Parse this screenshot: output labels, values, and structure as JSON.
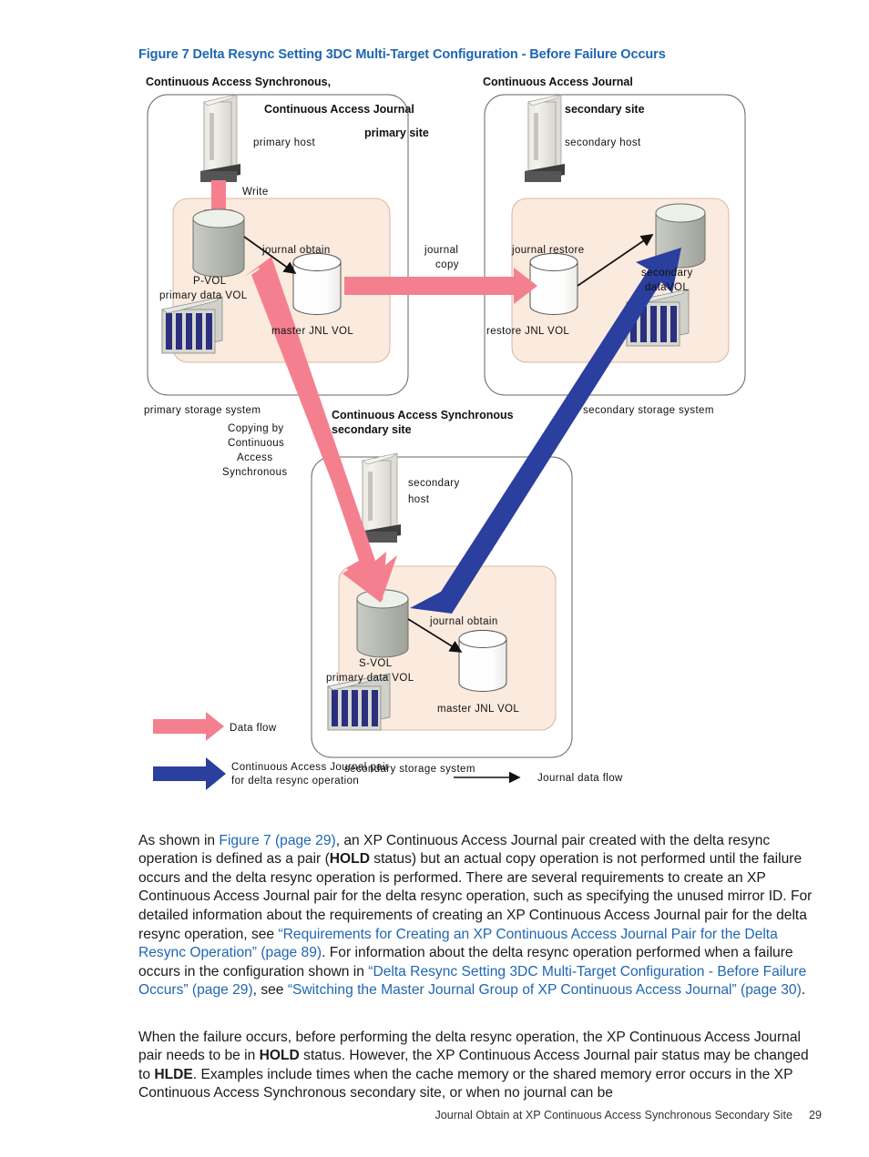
{
  "figure": {
    "caption": "Figure 7 Delta Resync Setting 3DC Multi-Target Configuration - Before Failure Occurs",
    "caption_color": "#1f66b0",
    "top_left_site": {
      "title_line1": "Continuous Access Synchronous,",
      "title_line2": "Continuous Access Journal",
      "title_line3": "primary site",
      "host_label": "primary host",
      "write_label": "Write",
      "data_vol_line1": "P-VOL",
      "data_vol_line2": "primary data VOL",
      "journal_obtain_label": "journal obtain",
      "jnl_vol_label": "master JNL VOL",
      "storage_system_label": "primary storage system"
    },
    "top_right_site": {
      "title_line1": "Continuous Access Journal",
      "title_line2": "secondary site",
      "host_label": "secondary host",
      "journal_restore_label": "journal restore",
      "data_vol_line1": "secondary",
      "data_vol_line2": "dataVOL",
      "jnl_vol_label": "restore JNL VOL",
      "storage_system_label": "secondary storage system"
    },
    "bottom_site": {
      "title_line1": "Continuous Access Synchronous",
      "title_line2": "secondary site",
      "host_line1": "secondary",
      "host_line2": "host",
      "data_vol_line1": "S-VOL",
      "data_vol_line2": "primary data VOL",
      "journal_obtain_label": "journal obtain",
      "jnl_vol_label": "master JNL VOL",
      "storage_system_label": "secondary storage system"
    },
    "journal_copy_label_line1": "journal",
    "journal_copy_label_line2": "copy",
    "copying_label_line1": "Copying by",
    "copying_label_line2": "Continuous",
    "copying_label_line3": "Access",
    "copying_label_line4": "Synchronous",
    "legend": {
      "data_flow": "Data flow",
      "ca_journal_pair_line1": "Continuous Access Journal pair",
      "ca_journal_pair_line2": "for delta resync operation",
      "journal_data_flow": "Journal data flow"
    },
    "colors": {
      "pink_arrow": "#f4808f",
      "blue_arrow": "#2a3f9e",
      "site_fill": "#fbeade",
      "gray_cylinder": "#b9bcb4",
      "white_cylinder": "#ffffff",
      "array_blue": "#2b2f7e",
      "outline": "#555555"
    }
  },
  "paragraph1": {
    "s1": "As shown in ",
    "link1": "Figure 7 (page 29)",
    "s2": ", an XP Continuous Access Journal pair created with the delta resync operation is defined as a pair (",
    "b1": "HOLD",
    "s3": " status) but an actual copy operation is not performed until the failure occurs and the delta resync operation is performed. There are several requirements to create an XP Continuous Access Journal pair for the delta resync operation, such as specifying the unused mirror ID. For detailed information about the requirements of creating an XP Continuous Access Journal pair for the delta resync operation, see ",
    "link2": "“Requirements for Creating an XP Continuous Access Journal Pair for the Delta Resync Operation” (page 89)",
    "s4": ". For information about the delta resync operation performed when a failure occurs in the configuration shown in ",
    "link3": "“Delta Resync Setting 3DC Multi-Target Configuration - Before Failure Occurs” (page 29)",
    "s5": ", see ",
    "link4": "“Switching the Master Journal Group of XP Continuous Access Journal” (page 30)",
    "s6": "."
  },
  "paragraph2": {
    "s1": "When the failure occurs, before performing the delta resync operation, the XP Continuous Access Journal pair needs to be in ",
    "b1": "HOLD",
    "s2": " status. However, the XP Continuous Access Journal pair status may be changed to ",
    "b2": "HLDE",
    "s3": ". Examples include times when the cache memory or the shared memory error occurs in the XP Continuous Access Synchronous secondary site, or when no journal can be"
  },
  "footer": {
    "running_head": "Journal Obtain at XP Continuous Access Synchronous Secondary Site",
    "page_number": "29"
  }
}
